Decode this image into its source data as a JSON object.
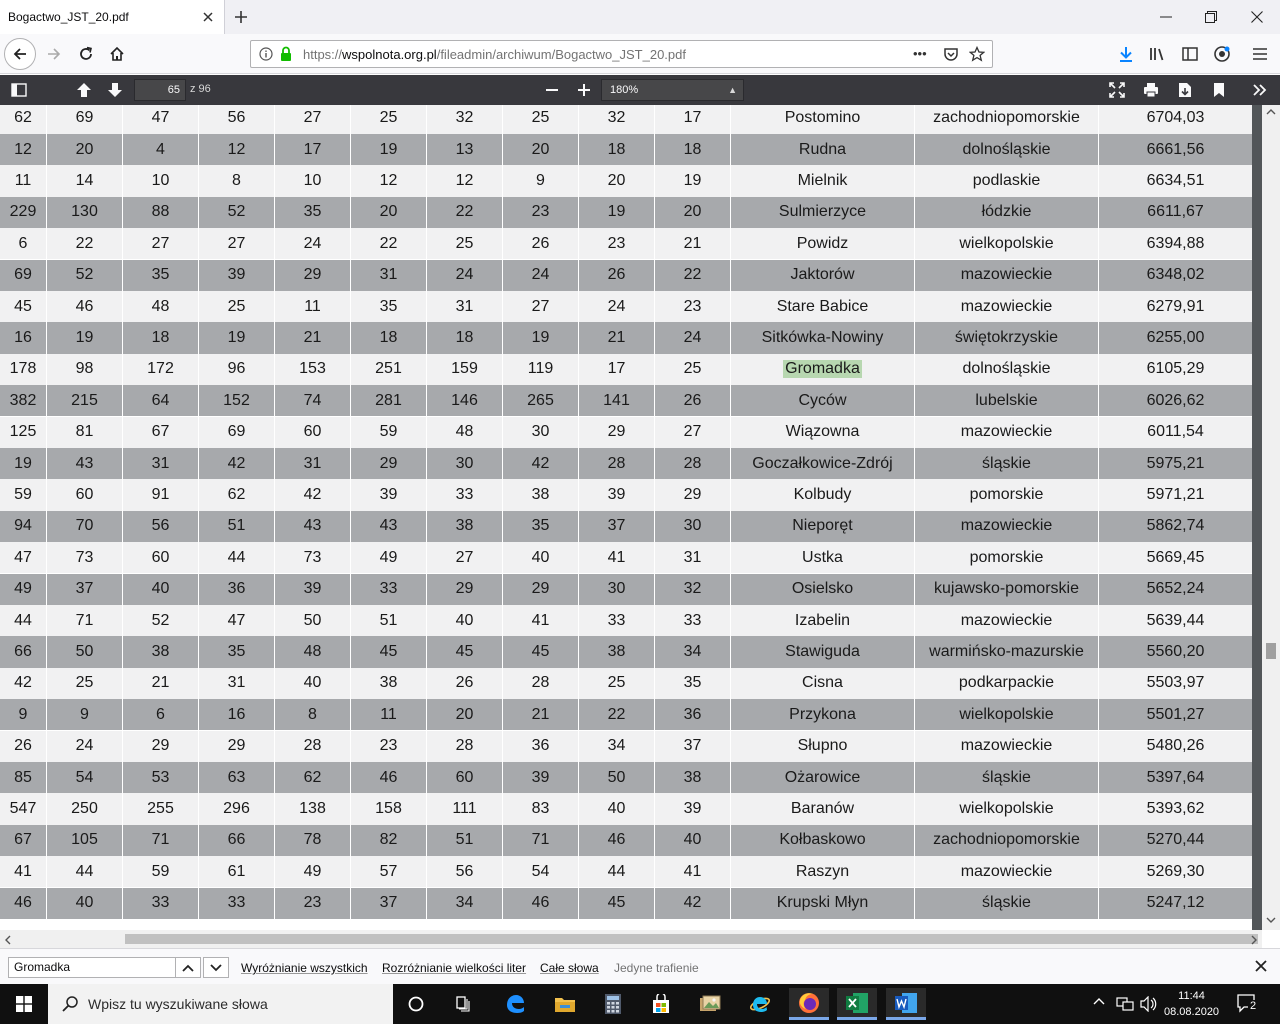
{
  "tab": {
    "title": "Bogactwo_JST_20.pdf"
  },
  "url": {
    "prefix": "https://",
    "host": "wspolnota.org.pl",
    "path": "/fileadmin/archiwum/Bogactwo_JST_20.pdf",
    "more": "•••"
  },
  "pdf_toolbar": {
    "page": "65",
    "total": "z 96",
    "zoom": "180%"
  },
  "table": {
    "highlight_term": "Gromadka",
    "rows": [
      [
        "62",
        "69",
        "47",
        "56",
        "27",
        "25",
        "32",
        "25",
        "32",
        "17",
        "Postomino",
        "zachodniopomorskie",
        "6704,03"
      ],
      [
        "12",
        "20",
        "4",
        "12",
        "17",
        "19",
        "13",
        "20",
        "18",
        "18",
        "Rudna",
        "dolnośląskie",
        "6661,56"
      ],
      [
        "11",
        "14",
        "10",
        "8",
        "10",
        "12",
        "12",
        "9",
        "20",
        "19",
        "Mielnik",
        "podlaskie",
        "6634,51"
      ],
      [
        "229",
        "130",
        "88",
        "52",
        "35",
        "20",
        "22",
        "23",
        "19",
        "20",
        "Sulmierzyce",
        "łódzkie",
        "6611,67"
      ],
      [
        "6",
        "22",
        "27",
        "27",
        "24",
        "22",
        "25",
        "26",
        "23",
        "21",
        "Powidz",
        "wielkopolskie",
        "6394,88"
      ],
      [
        "69",
        "52",
        "35",
        "39",
        "29",
        "31",
        "24",
        "24",
        "26",
        "22",
        "Jaktorów",
        "mazowieckie",
        "6348,02"
      ],
      [
        "45",
        "46",
        "48",
        "25",
        "11",
        "35",
        "31",
        "27",
        "24",
        "23",
        "Stare Babice",
        "mazowieckie",
        "6279,91"
      ],
      [
        "16",
        "19",
        "18",
        "19",
        "21",
        "18",
        "18",
        "19",
        "21",
        "24",
        "Sitkówka-Nowiny",
        "świętokrzyskie",
        "6255,00"
      ],
      [
        "178",
        "98",
        "172",
        "96",
        "153",
        "251",
        "159",
        "119",
        "17",
        "25",
        "Gromadka",
        "dolnośląskie",
        "6105,29"
      ],
      [
        "382",
        "215",
        "64",
        "152",
        "74",
        "281",
        "146",
        "265",
        "141",
        "26",
        "Cyców",
        "lubelskie",
        "6026,62"
      ],
      [
        "125",
        "81",
        "67",
        "69",
        "60",
        "59",
        "48",
        "30",
        "29",
        "27",
        "Wiązowna",
        "mazowieckie",
        "6011,54"
      ],
      [
        "19",
        "43",
        "31",
        "42",
        "31",
        "29",
        "30",
        "42",
        "28",
        "28",
        "Goczałkowice-Zdrój",
        "śląskie",
        "5975,21"
      ],
      [
        "59",
        "60",
        "91",
        "62",
        "42",
        "39",
        "33",
        "38",
        "39",
        "29",
        "Kolbudy",
        "pomorskie",
        "5971,21"
      ],
      [
        "94",
        "70",
        "56",
        "51",
        "43",
        "43",
        "38",
        "35",
        "37",
        "30",
        "Nieporęt",
        "mazowieckie",
        "5862,74"
      ],
      [
        "47",
        "73",
        "60",
        "44",
        "73",
        "49",
        "27",
        "40",
        "41",
        "31",
        "Ustka",
        "pomorskie",
        "5669,45"
      ],
      [
        "49",
        "37",
        "40",
        "36",
        "39",
        "33",
        "29",
        "29",
        "30",
        "32",
        "Osielsko",
        "kujawsko-pomorskie",
        "5652,24"
      ],
      [
        "44",
        "71",
        "52",
        "47",
        "50",
        "51",
        "40",
        "41",
        "33",
        "33",
        "Izabelin",
        "mazowieckie",
        "5639,44"
      ],
      [
        "66",
        "50",
        "38",
        "35",
        "48",
        "45",
        "45",
        "45",
        "38",
        "34",
        "Stawiguda",
        "warmińsko-mazurskie",
        "5560,20"
      ],
      [
        "42",
        "25",
        "21",
        "31",
        "40",
        "38",
        "26",
        "28",
        "25",
        "35",
        "Cisna",
        "podkarpackie",
        "5503,97"
      ],
      [
        "9",
        "9",
        "6",
        "16",
        "8",
        "11",
        "20",
        "21",
        "22",
        "36",
        "Przykona",
        "wielkopolskie",
        "5501,27"
      ],
      [
        "26",
        "24",
        "29",
        "29",
        "28",
        "23",
        "28",
        "36",
        "34",
        "37",
        "Słupno",
        "mazowieckie",
        "5480,26"
      ],
      [
        "85",
        "54",
        "53",
        "63",
        "62",
        "46",
        "60",
        "39",
        "50",
        "38",
        "Ożarowice",
        "śląskie",
        "5397,64"
      ],
      [
        "547",
        "250",
        "255",
        "296",
        "138",
        "158",
        "111",
        "83",
        "40",
        "39",
        "Baranów",
        "wielkopolskie",
        "5393,62"
      ],
      [
        "67",
        "105",
        "71",
        "66",
        "78",
        "82",
        "51",
        "71",
        "46",
        "40",
        "Kołbaskowo",
        "zachodniopomorskie",
        "5270,44"
      ],
      [
        "41",
        "44",
        "59",
        "61",
        "49",
        "57",
        "56",
        "54",
        "44",
        "41",
        "Raszyn",
        "mazowieckie",
        "5269,30"
      ],
      [
        "46",
        "40",
        "33",
        "33",
        "23",
        "37",
        "34",
        "46",
        "45",
        "42",
        "Krupski Młyn",
        "śląskie",
        "5247,12"
      ]
    ]
  },
  "findbar": {
    "query": "Gromadka",
    "highlight_all": "Wyróżnianie wszystkich",
    "match_case": "Rozróżnianie wielkości liter",
    "whole_words": "Całe słowa",
    "status": "Jedyne trafienie"
  },
  "taskbar": {
    "search_placeholder": "Wpisz tu wyszukiwane słowa",
    "time": "11:44",
    "date": "08.08.2020",
    "notifications": "2"
  },
  "colors": {
    "pdf_toolbar": "#38383d",
    "row_alt": "#a7a9ac",
    "row_light": "#f1f1f2",
    "highlight": "#b7d7b0",
    "download_blue": "#0a84ff"
  }
}
